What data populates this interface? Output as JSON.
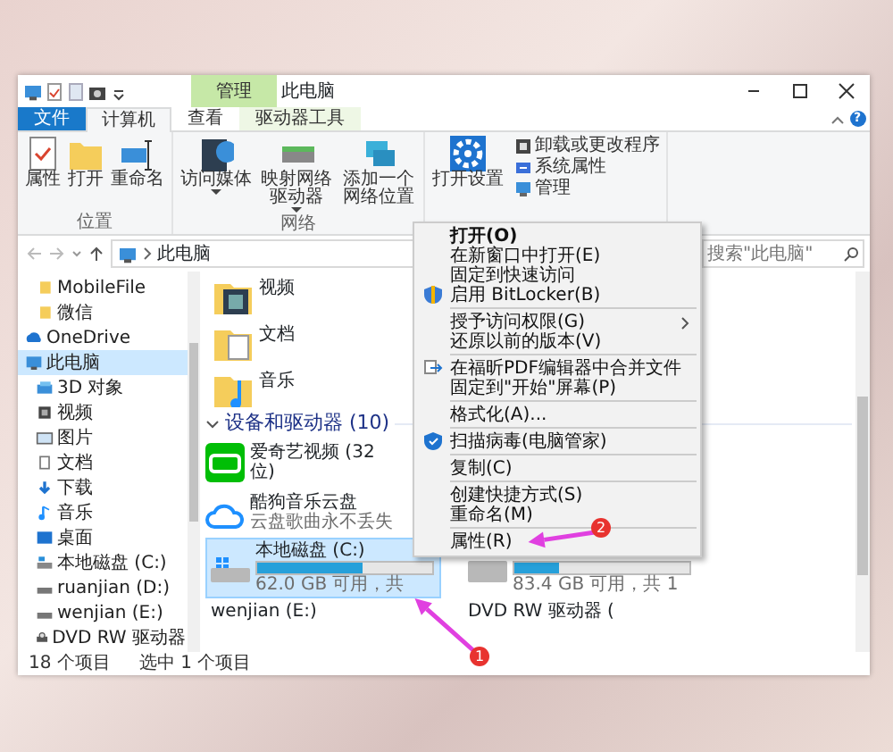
{
  "title_bar": {
    "context_tab": "管理",
    "title": "此电脑"
  },
  "ribbon_tabs": [
    {
      "label": "文件",
      "kind": "file",
      "selected": false
    },
    {
      "label": "计算机",
      "kind": "tab",
      "selected": true
    },
    {
      "label": "查看",
      "kind": "tab",
      "selected": false
    },
    {
      "label": "驱动器工具",
      "kind": "context",
      "selected": false
    }
  ],
  "ribbon_groups": [
    {
      "label": "位置",
      "buttons": [
        {
          "label": "属性"
        },
        {
          "label": "打开"
        },
        {
          "label": "重命名"
        }
      ]
    },
    {
      "label": "网络",
      "buttons": [
        {
          "label": "访问媒体",
          "dropdown": true
        },
        {
          "label": "映射网络驱动器",
          "dropdown": true
        },
        {
          "label": "添加一个网络位置",
          "dropdown": false
        }
      ]
    },
    {
      "buttons": [
        {
          "label": "打开设置",
          "dropdown": false
        }
      ],
      "small_buttons": [
        {
          "label": "卸载或更改程序"
        },
        {
          "label": "系统属性"
        },
        {
          "label": "管理"
        }
      ]
    }
  ],
  "help": "?",
  "address": {
    "path": "此电脑",
    "search_placeholder": "搜索\"此电脑\""
  },
  "nav_pane": [
    {
      "children": [
        {
          "label": "MobileFile",
          "selected": false
        },
        {
          "label": "微信",
          "selected": false
        }
      ]
    },
    {
      "label": "OneDrive",
      "selected": false
    },
    {
      "label": "此电脑",
      "selected": true,
      "children": [
        {
          "label": "3D 对象",
          "selected": false
        },
        {
          "label": "视频",
          "selected": false
        },
        {
          "label": "图片",
          "selected": false
        },
        {
          "label": "文档",
          "selected": false
        },
        {
          "label": "下载",
          "selected": false
        },
        {
          "label": "音乐",
          "selected": false
        },
        {
          "label": "桌面",
          "selected": false
        },
        {
          "label": "本地磁盘 (C:)",
          "selected": false
        },
        {
          "label": "ruanjian (D:)",
          "selected": false
        },
        {
          "label": "wenjian (E:)",
          "selected": false
        },
        {
          "label": "DVD RW 驱动器",
          "selected": false
        }
      ]
    }
  ],
  "folders": [
    {
      "label": "视频"
    },
    {
      "label": "文档"
    },
    {
      "label": "音乐"
    }
  ],
  "section": {
    "label": "设备和驱动器 (10)",
    "expanded": true
  },
  "devices": [
    {
      "kind": "app",
      "name": "爱奇艺视频 (32 位)"
    },
    {
      "kind": "app",
      "name": "酷狗音乐云盘",
      "subtitle": "云盘歌曲永不丢失"
    },
    {
      "kind": "drive",
      "name": "本地磁盘 (C:)",
      "free": "62.0 GB 可用，共",
      "level": 0.6,
      "selected": true
    },
    {
      "kind": "drive",
      "free": "83.4 GB 可用，共 1",
      "level": 0.25,
      "selected": false
    },
    {
      "kind": "drive",
      "name": "wenjian (E:)",
      "selected": false
    },
    {
      "kind": "drive",
      "name": "DVD RW 驱动器 (",
      "selected": false
    }
  ],
  "status_bar": {
    "count": "18 个项目",
    "selection": "选中 1 个项目"
  },
  "context_menu": [
    {
      "kind": "item",
      "label": "打开(O)",
      "default": true,
      "submenu": false
    },
    {
      "kind": "item",
      "label": "在新窗口中打开(E)",
      "default": false,
      "submenu": false
    },
    {
      "kind": "item",
      "label": "固定到快速访问",
      "default": false,
      "submenu": false
    },
    {
      "kind": "item",
      "label": "启用 BitLocker(B)",
      "default": false,
      "submenu": false
    },
    {
      "kind": "separator"
    },
    {
      "kind": "item",
      "label": "授予访问权限(G)",
      "default": false,
      "submenu": true
    },
    {
      "kind": "item",
      "label": "还原以前的版本(V)",
      "default": false,
      "submenu": false
    },
    {
      "kind": "separator"
    },
    {
      "kind": "item",
      "label": "在福昕PDF编辑器中合并文件",
      "default": false,
      "submenu": false
    },
    {
      "kind": "item",
      "label": "固定到\"开始\"屏幕(P)",
      "default": false,
      "submenu": false
    },
    {
      "kind": "separator"
    },
    {
      "kind": "item",
      "label": "格式化(A)...",
      "default": false,
      "submenu": false
    },
    {
      "kind": "separator"
    },
    {
      "kind": "item",
      "label": "扫描病毒(电脑管家)",
      "default": false,
      "submenu": false
    },
    {
      "kind": "separator"
    },
    {
      "kind": "item",
      "label": "复制(C)",
      "default": false,
      "submenu": false
    },
    {
      "kind": "separator"
    },
    {
      "kind": "item",
      "label": "创建快捷方式(S)",
      "default": false,
      "submenu": false
    },
    {
      "kind": "item",
      "label": "重命名(M)",
      "default": false,
      "submenu": false
    },
    {
      "kind": "separator"
    },
    {
      "kind": "item",
      "label": "属性(R)",
      "default": false,
      "submenu": false
    }
  ],
  "annotations": [
    {
      "label": "1"
    },
    {
      "label": "2"
    }
  ]
}
